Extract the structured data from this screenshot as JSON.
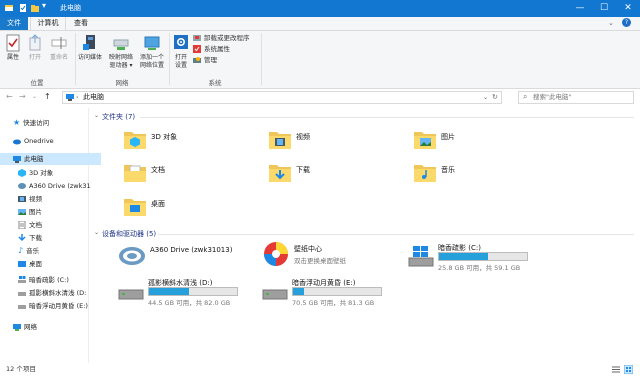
{
  "window": {
    "title": "此电脑",
    "minimize": "—",
    "maximize": "☐",
    "close": "✕"
  },
  "ribbon_tabs": [
    "文件",
    "计算机",
    "查看"
  ],
  "ribbon": {
    "location_group": {
      "label": "位置",
      "properties": "属性",
      "open": "打开",
      "rename": "重命名"
    },
    "network_group": {
      "label": "网络",
      "access_media": "访问媒体",
      "map_drive_l1": "映射网络",
      "map_drive_l2": "驱动器",
      "add_location_l1": "添加一个",
      "add_location_l2": "网络位置"
    },
    "system_group": {
      "label": "系统",
      "open_settings_l1": "打开",
      "open_settings_l2": "设置",
      "uninstall": "卸载或更改程序",
      "system_props": "系统属性",
      "manage": "管理"
    }
  },
  "address": {
    "path": "此电脑",
    "search_placeholder": "搜索\"此电脑\""
  },
  "nav": {
    "quick_access": "快速访问",
    "onedrive": "Onedrive",
    "this_pc": "此电脑",
    "items": [
      "3D 对象",
      "A360 Drive (zwk31",
      "视频",
      "图片",
      "文档",
      "下载",
      "音乐",
      "桌面",
      "暗香疏影 (C:)",
      "孤影横斜水清浅 (D:",
      "暗香浮动月黄昏 (E:)"
    ],
    "network": "网络"
  },
  "folders_section": {
    "header": "文件夹 (7)",
    "folders": [
      "3D 对象",
      "视频",
      "图片",
      "文档",
      "下载",
      "音乐",
      "桌面"
    ]
  },
  "drives_section": {
    "header": "设备和驱动器 (5)",
    "a360": {
      "name": "A360 Drive (zwk31013)"
    },
    "wallpaper": {
      "name": "壁纸中心",
      "sub": "双击更换桌面壁纸"
    },
    "drives": [
      {
        "name": "暗香疏影 (C:)",
        "sub": "25.8 GB 可用，共 59.1 GB",
        "used": 0.56
      },
      {
        "name": "孤影横斜水清浅 (D:)",
        "sub": "44.5 GB 可用，共 82.0 GB",
        "used": 0.46
      },
      {
        "name": "暗香浮动月黄昏 (E:)",
        "sub": "70.5 GB 可用，共 81.3 GB",
        "used": 0.13
      }
    ]
  },
  "status": {
    "count": "12 个项目"
  }
}
